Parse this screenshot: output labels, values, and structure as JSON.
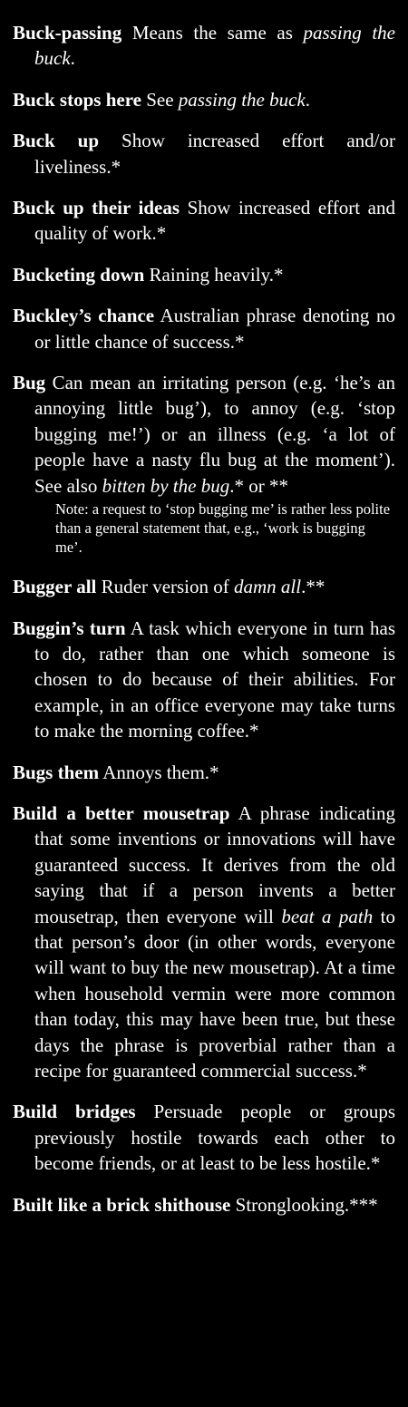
{
  "entries": [
    {
      "term": "Buck-passing",
      "parts": [
        {
          "t": " Means the same as "
        },
        {
          "t": "passing the buck",
          "i": true
        },
        {
          "t": "."
        }
      ]
    },
    {
      "term": "Buck stops here",
      "parts": [
        {
          "t": " See "
        },
        {
          "t": "passing the buck",
          "i": true
        },
        {
          "t": "."
        }
      ]
    },
    {
      "term": "Buck up",
      "parts": [
        {
          "t": " Show increased effort and/or liveliness.*"
        }
      ]
    },
    {
      "term": "Buck up their ideas",
      "parts": [
        {
          "t": " Show increased effort and quality of work.*"
        }
      ]
    },
    {
      "term": "Bucketing down",
      "parts": [
        {
          "t": " Raining heavily.*"
        }
      ]
    },
    {
      "term": "Buckley’s chance",
      "parts": [
        {
          "t": " Australian phrase denoting no or little chance of success.*"
        }
      ]
    },
    {
      "term": "Bug",
      "parts": [
        {
          "t": " Can mean an irritating person (e.g. ‘he’s an annoying little bug’), to annoy (e.g. ‘stop bugging me!’) or an illness (e.g. ‘a lot of people have a nasty flu bug at the moment’). See also "
        },
        {
          "t": "bitten by the bug",
          "i": true
        },
        {
          "t": ".* or **"
        }
      ],
      "note": "Note: a request to ‘stop bugging me’ is rather less polite than a general statement that, e.g., ‘work is bugging me’."
    },
    {
      "term": "Bugger all",
      "parts": [
        {
          "t": " Ruder version of "
        },
        {
          "t": "damn all",
          "i": true
        },
        {
          "t": ".**"
        }
      ]
    },
    {
      "term": "Buggin’s turn",
      "parts": [
        {
          "t": " A task which everyone in turn has to do, rather than one which someone is chosen to do because of their abilities. For example, in an office everyone may take turns to make the morning coffee.*"
        }
      ]
    },
    {
      "term": "Bugs them",
      "parts": [
        {
          "t": " Annoys them.*"
        }
      ]
    },
    {
      "term": "Build a better mousetrap",
      "parts": [
        {
          "t": " A phrase indi­cating that some inventions or innova­tions will have guaranteed success. It derives from the old saying that if a person invents a better mousetrap, then everyone will "
        },
        {
          "t": "beat a path",
          "i": true
        },
        {
          "t": " to that person’s door (in other words, everyone will want to buy the new mousetrap). At a time when household vermin were more common than today, this may have been true, but these days the phrase is prover­bial rather than a recipe for guaranteed commercial success.*"
        }
      ]
    },
    {
      "term": "Build bridges",
      "parts": [
        {
          "t": " Persuade people or groups previously hostile towards each other to become friends, or at least to be less hostile.*"
        }
      ]
    },
    {
      "term": "Built like a brick shithouse",
      "parts": [
        {
          "t": " Strong­looking.***"
        }
      ]
    }
  ]
}
